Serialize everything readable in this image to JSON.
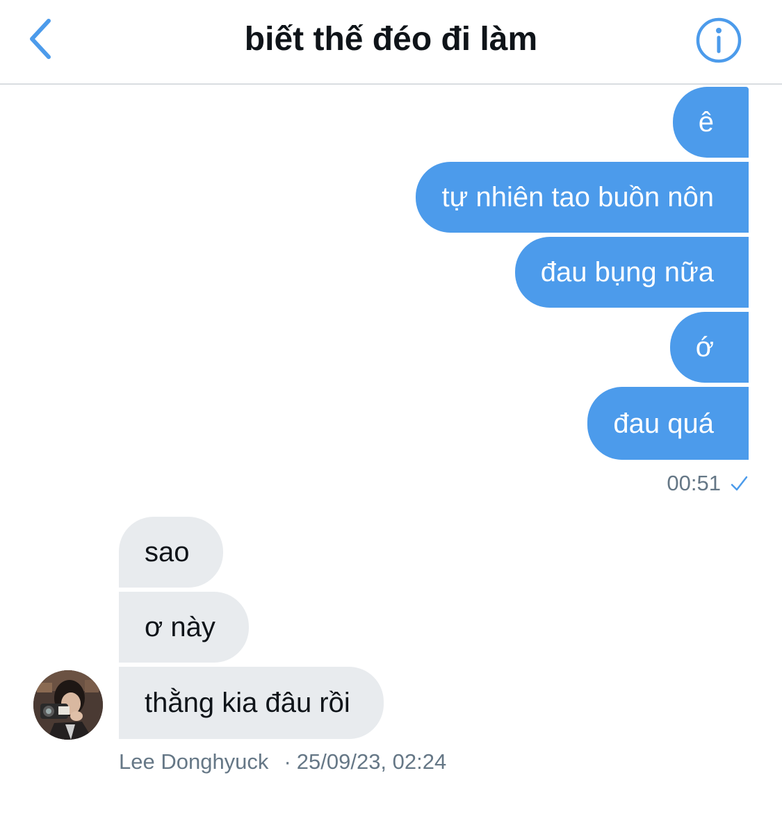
{
  "header": {
    "title": "biết thế đéo đi làm",
    "back_icon": "chevron-left-icon",
    "info_icon": "info-icon",
    "accent_color": "#4c9beb"
  },
  "messages_sent": [
    {
      "text": "ê"
    },
    {
      "text": "tự nhiên tao buồn nôn"
    },
    {
      "text": "đau bụng nữa"
    },
    {
      "text": "ớ"
    },
    {
      "text": "đau quá"
    }
  ],
  "sent_meta": {
    "time": "00:51",
    "status_icon": "checkmark-icon"
  },
  "messages_received": [
    {
      "text": "sao"
    },
    {
      "text": "ơ này"
    },
    {
      "text": "thằng kia đâu rồi"
    }
  ],
  "received_meta": {
    "sender": "Lee Donghyuck",
    "separator": "·",
    "timestamp": "25/09/23, 02:24"
  },
  "colors": {
    "sent_bubble": "#4c9beb",
    "received_bubble": "#e8ebee",
    "meta_text": "#657786"
  }
}
